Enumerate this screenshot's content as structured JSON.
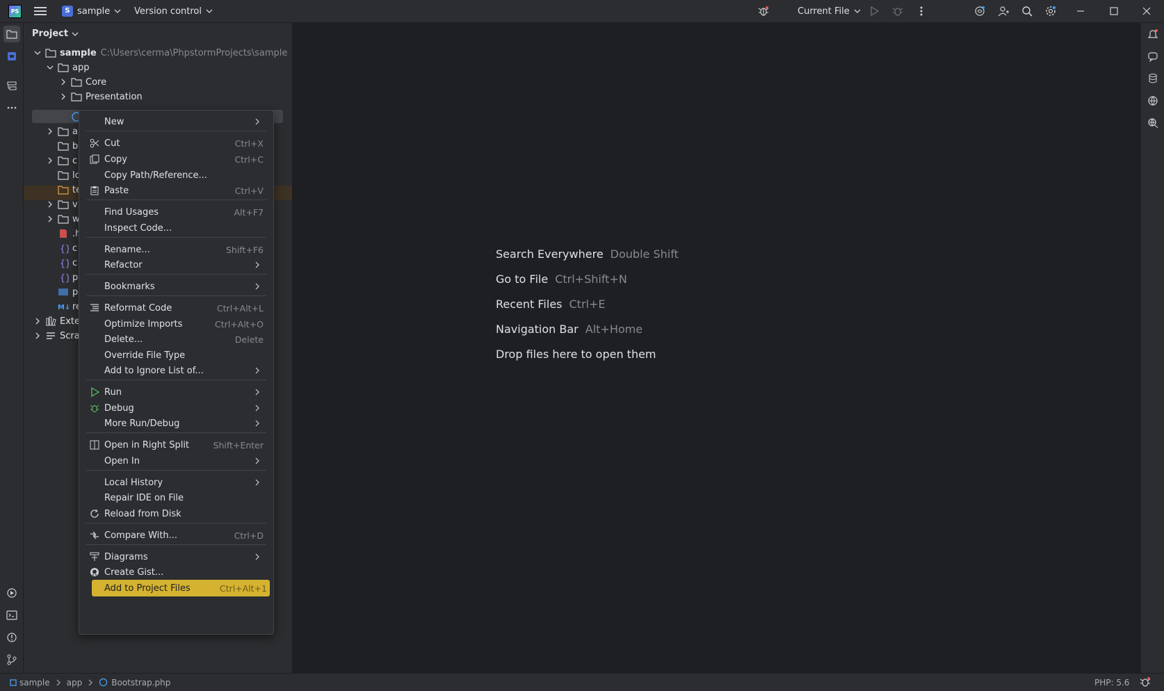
{
  "titlebar": {
    "logo_text": "PS",
    "project_badge": "S",
    "project_name": "sample",
    "vcs_label": "Version control",
    "run_config": "Current File"
  },
  "project_panel": {
    "header": "Project",
    "root_name": "sample",
    "root_path": "C:\\Users\\cerma\\PhpstormProjects\\sample",
    "app": "app",
    "core": "Core",
    "presentation": "Presentation",
    "partial_rows": [
      "a",
      "b",
      "c",
      "lc",
      "te",
      "v",
      "w",
      ".h",
      "c",
      "c",
      "p",
      "p",
      "re"
    ],
    "external": "Exte",
    "scratches": "Scra"
  },
  "editor_hints": [
    {
      "label": "Search Everywhere",
      "shortcut": "Double Shift"
    },
    {
      "label": "Go to File",
      "shortcut": "Ctrl+Shift+N"
    },
    {
      "label": "Recent Files",
      "shortcut": "Ctrl+E"
    },
    {
      "label": "Navigation Bar",
      "shortcut": "Alt+Home"
    },
    {
      "label": "Drop files here to open them",
      "shortcut": ""
    }
  ],
  "context_menu": {
    "items": [
      {
        "label": "New",
        "shortcut": "",
        "submenu": true,
        "icon": ""
      },
      {
        "label": "Cut",
        "shortcut": "Ctrl+X",
        "submenu": false,
        "icon": "scissors-icon"
      },
      {
        "label": "Copy",
        "shortcut": "Ctrl+C",
        "submenu": false,
        "icon": "copy-icon"
      },
      {
        "label": "Copy Path/Reference...",
        "shortcut": "",
        "submenu": false,
        "icon": ""
      },
      {
        "label": "Paste",
        "shortcut": "Ctrl+V",
        "submenu": false,
        "icon": "paste-icon"
      },
      {
        "label": "Find Usages",
        "shortcut": "Alt+F7",
        "submenu": false,
        "icon": ""
      },
      {
        "label": "Inspect Code...",
        "shortcut": "",
        "submenu": false,
        "icon": ""
      },
      {
        "label": "Rename...",
        "shortcut": "Shift+F6",
        "submenu": false,
        "icon": ""
      },
      {
        "label": "Refactor",
        "shortcut": "",
        "submenu": true,
        "icon": ""
      },
      {
        "label": "Bookmarks",
        "shortcut": "",
        "submenu": true,
        "icon": ""
      },
      {
        "label": "Reformat Code",
        "shortcut": "Ctrl+Alt+L",
        "submenu": false,
        "icon": "reformat-icon"
      },
      {
        "label": "Optimize Imports",
        "shortcut": "Ctrl+Alt+O",
        "submenu": false,
        "icon": ""
      },
      {
        "label": "Delete...",
        "shortcut": "Delete",
        "submenu": false,
        "icon": ""
      },
      {
        "label": "Override File Type",
        "shortcut": "",
        "submenu": false,
        "icon": ""
      },
      {
        "label": "Add to Ignore List of...",
        "shortcut": "",
        "submenu": true,
        "icon": ""
      },
      {
        "label": "Run",
        "shortcut": "",
        "submenu": true,
        "icon": "run-icon"
      },
      {
        "label": "Debug",
        "shortcut": "",
        "submenu": true,
        "icon": "debug-icon"
      },
      {
        "label": "More Run/Debug",
        "shortcut": "",
        "submenu": true,
        "icon": ""
      },
      {
        "label": "Open in Right Split",
        "shortcut": "Shift+Enter",
        "submenu": false,
        "icon": "split-icon"
      },
      {
        "label": "Open In",
        "shortcut": "",
        "submenu": true,
        "icon": ""
      },
      {
        "label": "Local History",
        "shortcut": "",
        "submenu": true,
        "icon": ""
      },
      {
        "label": "Repair IDE on File",
        "shortcut": "",
        "submenu": false,
        "icon": ""
      },
      {
        "label": "Reload from Disk",
        "shortcut": "",
        "submenu": false,
        "icon": "reload-icon"
      },
      {
        "label": "Compare With...",
        "shortcut": "Ctrl+D",
        "submenu": false,
        "icon": "compare-icon"
      },
      {
        "label": "Diagrams",
        "shortcut": "",
        "submenu": true,
        "icon": "diagram-icon"
      },
      {
        "label": "Create Gist...",
        "shortcut": "",
        "submenu": false,
        "icon": "github-icon"
      },
      {
        "label": "Add to Project Files",
        "shortcut": "Ctrl+Alt+1",
        "submenu": false,
        "icon": "",
        "selected": true
      }
    ]
  },
  "statusbar": {
    "crumbs": [
      "sample",
      "app",
      "Bootstrap.php"
    ],
    "php_version": "PHP: 5.6"
  },
  "colors": {
    "bg": "#1e1f22",
    "panel": "#2b2d30",
    "selection": "#d5b22f",
    "accent": "#4a6fd8"
  }
}
